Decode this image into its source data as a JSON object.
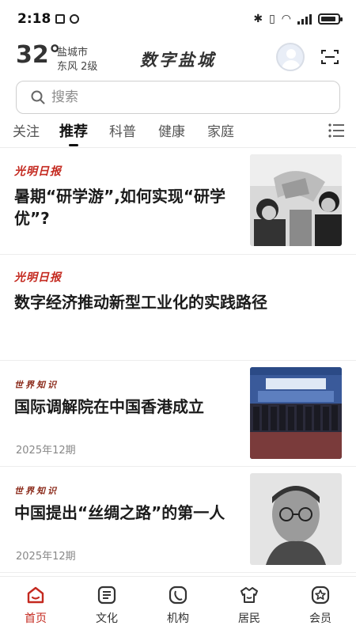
{
  "status_bar": {
    "time": "2:18"
  },
  "header": {
    "temperature": "32°",
    "city": "盐城市",
    "wind": "东风  2级",
    "app_title": "数字盐城"
  },
  "search": {
    "placeholder": "搜索"
  },
  "tabs": [
    {
      "label": "关注"
    },
    {
      "label": "推荐",
      "active": true
    },
    {
      "label": "科普"
    },
    {
      "label": "健康"
    },
    {
      "label": "家庭"
    }
  ],
  "feed": [
    {
      "source": "光明日报",
      "title_line1": "暑期“研学游”,如何实现“研学",
      "title_line2": "优”?",
      "date": ""
    },
    {
      "source": "光明日报",
      "title_line1": "数字经济推动新型工业化的实践路径",
      "title_line2": "",
      "date": ""
    },
    {
      "source": "世界知识",
      "title_line1": "国际调解院在中国香港成立",
      "title_line2": "",
      "date": "2025年12期"
    },
    {
      "source": "世界知识",
      "title_line1": "中国提出“丝绸之路”的第一人",
      "title_line2": "",
      "date": "2025年12期"
    }
  ],
  "bottom_nav": [
    {
      "label": "首页",
      "icon": "home-icon",
      "active": true
    },
    {
      "label": "文化",
      "icon": "culture-icon"
    },
    {
      "label": "机构",
      "icon": "institution-icon"
    },
    {
      "label": "居民",
      "icon": "resident-icon"
    },
    {
      "label": "会员",
      "icon": "member-icon"
    }
  ],
  "colors": {
    "accent": "#c4291f",
    "text": "#1b1b1b",
    "muted": "#888888"
  }
}
